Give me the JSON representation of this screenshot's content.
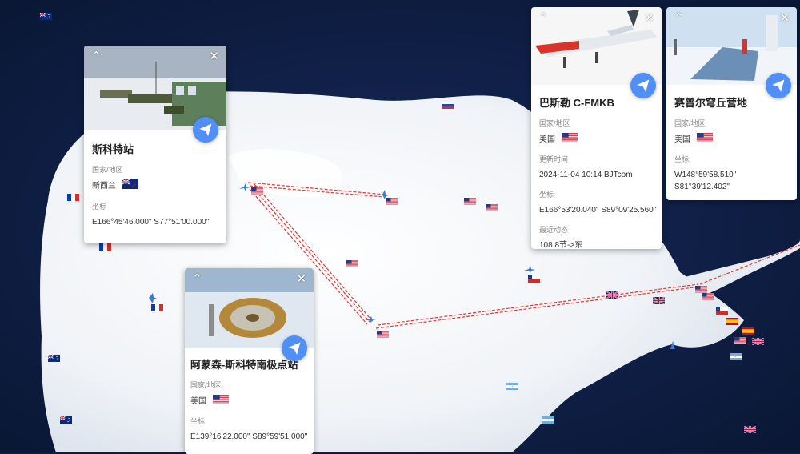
{
  "map": {
    "colors": {
      "ocean": "#0d1c40",
      "ice": "#f1f4f8",
      "route": "#e53935",
      "button": "#4f8ff7"
    }
  },
  "cards": {
    "scott": {
      "title": "斯科特站",
      "region_label": "国家/地区",
      "region_value": "新西兰",
      "region_flag": "nz",
      "coord_label": "坐标",
      "coord_value": "E166°45'46.000\" S77°51'00.000\""
    },
    "amundsen": {
      "title": "阿蒙森-斯科特南极点站",
      "region_label": "国家/地区",
      "region_value": "美国",
      "region_flag": "us",
      "coord_label": "坐标",
      "coord_value": "E139°16'22.000\" S89°59'51.000\""
    },
    "aircraft": {
      "title": "巴斯勒 C-FMKB",
      "region_label": "国家/地区",
      "region_value": "美国",
      "region_flag": "us",
      "update_label": "更新时间",
      "update_value": "2024-11-04 10:14 BJTcom",
      "coord_label": "坐标",
      "coord_value": "E166°53'20.040\" S89°09'25.560\"",
      "recent_label": "最近动态",
      "recent_value": "108.8节->东"
    },
    "camp": {
      "title": "赛普尔穹丘营地",
      "region_label": "国家/地区",
      "region_value": "美国",
      "region_flag": "us",
      "coord_label": "坐标",
      "coord_value_line1": "W148°59'58.510\"",
      "coord_value_line2": "S81°39'12.402\""
    }
  }
}
